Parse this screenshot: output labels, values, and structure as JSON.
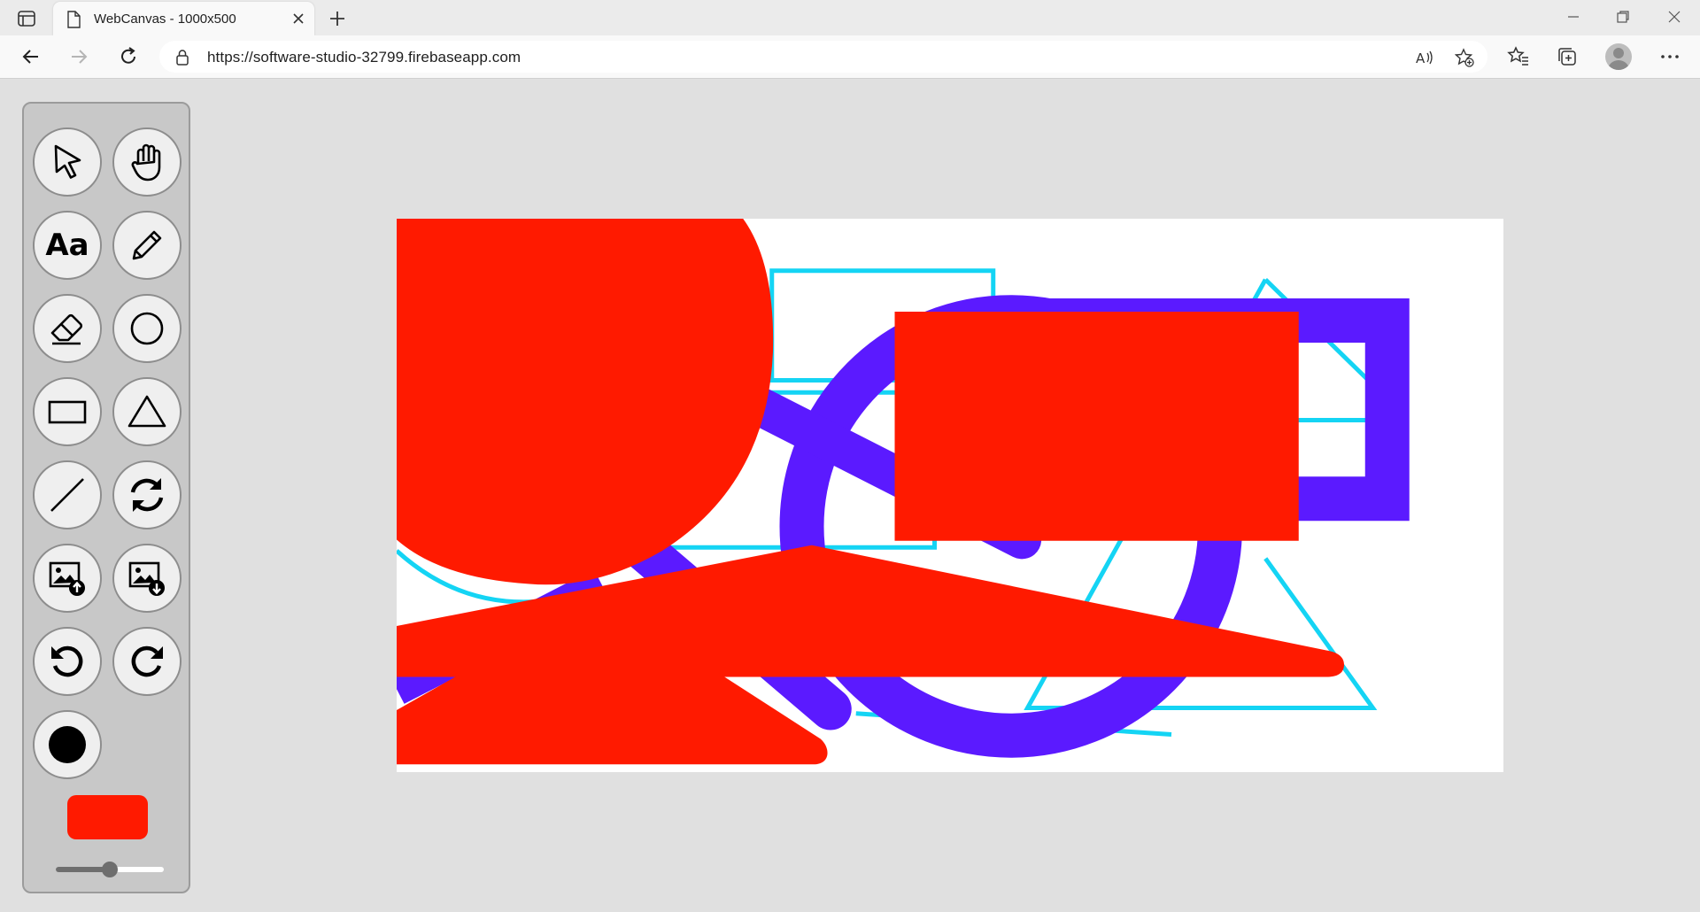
{
  "browser": {
    "tab_title": "WebCanvas - 1000x500",
    "url": "https://software-studio-32799.firebaseapp.com"
  },
  "toolbar": {
    "text_tool_glyph": "Aa",
    "tools": [
      "select",
      "pan",
      "text",
      "pencil",
      "eraser",
      "circle",
      "rectangle",
      "triangle",
      "line",
      "reset",
      "upload-image",
      "download-image",
      "undo",
      "redo",
      "brush-shape"
    ],
    "current_color": "#ff1a00",
    "brush_size_fraction": 0.5
  },
  "canvas": {
    "width": 1000,
    "height": 500,
    "colors": {
      "red": "#ff1a00",
      "purple": "#5b1aff",
      "cyan": "#14d4f4"
    }
  }
}
